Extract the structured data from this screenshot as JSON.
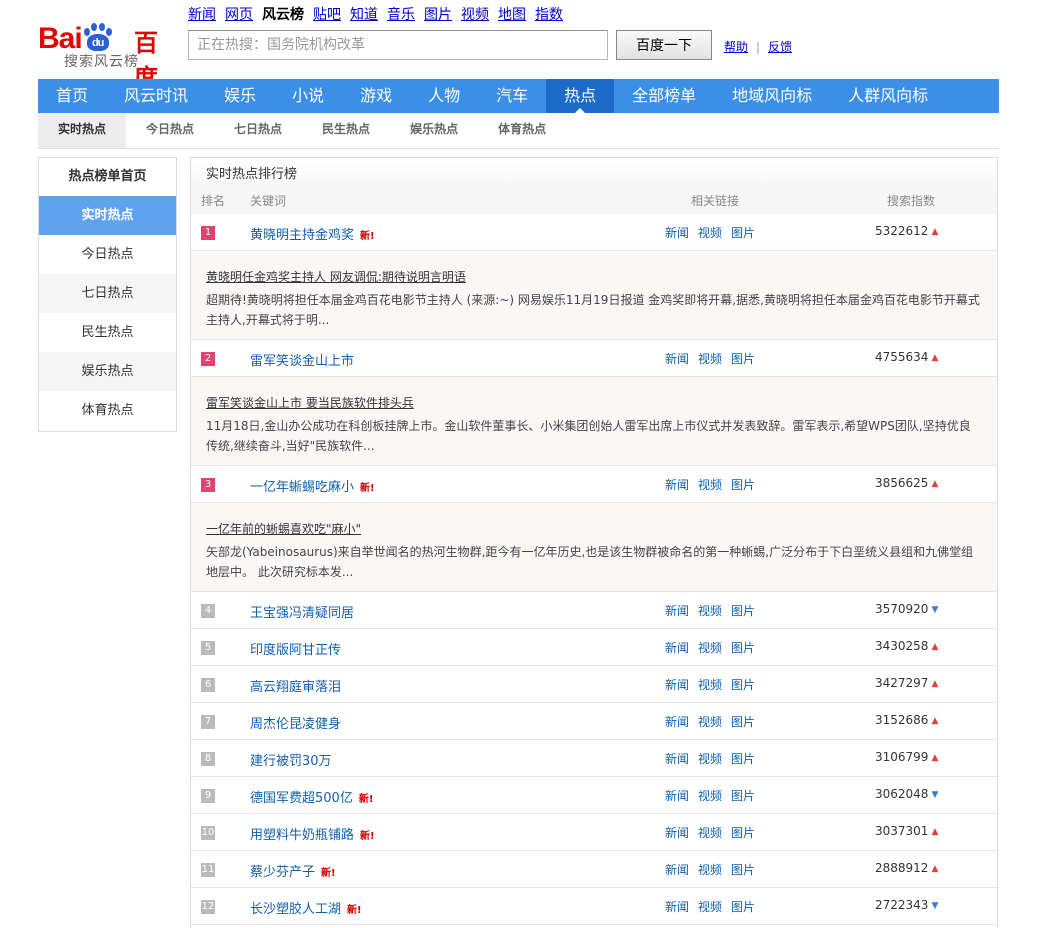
{
  "logo": {
    "latin_a": "Bai",
    "latin_b": "du",
    "cn": "百度",
    "sub": "搜索风云榜"
  },
  "topnav": [
    {
      "label": "新闻",
      "current": false
    },
    {
      "label": "网页",
      "current": false
    },
    {
      "label": "风云榜",
      "current": true
    },
    {
      "label": "贴吧",
      "current": false
    },
    {
      "label": "知道",
      "current": false
    },
    {
      "label": "音乐",
      "current": false
    },
    {
      "label": "图片",
      "current": false
    },
    {
      "label": "视频",
      "current": false
    },
    {
      "label": "地图",
      "current": false
    },
    {
      "label": "指数",
      "current": false
    }
  ],
  "search": {
    "value": "正在热搜：国务院机构改革",
    "button": "百度一下",
    "help": "帮助",
    "sep": "|",
    "feedback": "反馈"
  },
  "mainnav": [
    {
      "label": "首页",
      "current": false
    },
    {
      "label": "风云时讯",
      "current": false
    },
    {
      "label": "娱乐",
      "current": false
    },
    {
      "label": "小说",
      "current": false
    },
    {
      "label": "游戏",
      "current": false
    },
    {
      "label": "人物",
      "current": false
    },
    {
      "label": "汽车",
      "current": false
    },
    {
      "label": "热点",
      "current": true
    },
    {
      "label": "全部榜单",
      "current": false
    },
    {
      "label": "地域风向标",
      "current": false
    },
    {
      "label": "人群风向标",
      "current": false
    }
  ],
  "subnav": [
    {
      "label": "实时热点",
      "current": true
    },
    {
      "label": "今日热点",
      "current": false
    },
    {
      "label": "七日热点",
      "current": false
    },
    {
      "label": "民生热点",
      "current": false
    },
    {
      "label": "娱乐热点",
      "current": false
    },
    {
      "label": "体育热点",
      "current": false
    }
  ],
  "sidebar": {
    "head": "热点榜单首页",
    "items": [
      {
        "label": "实时热点",
        "current": true
      },
      {
        "label": "今日热点",
        "current": false
      },
      {
        "label": "七日热点",
        "current": false
      },
      {
        "label": "民生热点",
        "current": false
      },
      {
        "label": "娱乐热点",
        "current": false
      },
      {
        "label": "体育热点",
        "current": false
      }
    ]
  },
  "main": {
    "title": "实时热点排行榜",
    "columns": {
      "rank": "排名",
      "keyword": "关键词",
      "links": "相关链接",
      "index": "搜索指数"
    },
    "link_labels": [
      "新闻",
      "视频",
      "图片"
    ],
    "new_label": "新!",
    "rows": [
      {
        "rank": "1",
        "keyword": "黄晓明主持金鸡奖",
        "new": true,
        "index": "5322612",
        "trend": "up",
        "detail": {
          "title": "黄晓明任金鸡奖主持人 网友调侃:期待说明言明语",
          "text": "超期待!黄晓明将担任本届金鸡百花电影节主持人 (来源:~) 网易娱乐11月19日报道 金鸡奖即将开幕,据悉,黄晓明将担任本届金鸡百花电影节开幕式主持人,开幕式将于明..."
        }
      },
      {
        "rank": "2",
        "keyword": "雷军笑谈金山上市",
        "new": false,
        "index": "4755634",
        "trend": "up",
        "detail": {
          "title": "雷军笑谈金山上市 要当民族软件排头兵",
          "text": "11月18日,金山办公成功在科创板挂牌上市。金山软件董事长、小米集团创始人雷军出席上市仪式并发表致辞。雷军表示,希望WPS团队,坚持优良传统,继续奋斗,当好\"民族软件..."
        }
      },
      {
        "rank": "3",
        "keyword": "一亿年蜥蜴吃麻小",
        "new": true,
        "index": "3856625",
        "trend": "up",
        "detail": {
          "title": "一亿年前的蜥蜴喜欢吃\"麻小\"",
          "text": "矢部龙(Yabeinosaurus)来自举世闻名的热河生物群,距今有一亿年历史,也是该生物群被命名的第一种蜥蜴,广泛分布于下白垩统义县组和九佛堂组地层中。 此次研究标本发..."
        }
      },
      {
        "rank": "4",
        "keyword": "王宝强冯清疑同居",
        "new": false,
        "index": "3570920",
        "trend": "down"
      },
      {
        "rank": "5",
        "keyword": "印度版阿甘正传",
        "new": false,
        "index": "3430258",
        "trend": "up"
      },
      {
        "rank": "6",
        "keyword": "高云翔庭审落泪",
        "new": false,
        "index": "3427297",
        "trend": "up"
      },
      {
        "rank": "7",
        "keyword": "周杰伦昆凌健身",
        "new": false,
        "index": "3152686",
        "trend": "up"
      },
      {
        "rank": "8",
        "keyword": "建行被罚30万",
        "new": false,
        "index": "3106799",
        "trend": "up"
      },
      {
        "rank": "9",
        "keyword": "德国军费超500亿",
        "new": true,
        "index": "3062048",
        "trend": "down"
      },
      {
        "rank": "10",
        "keyword": "用塑料牛奶瓶铺路",
        "new": true,
        "index": "3037301",
        "trend": "up"
      },
      {
        "rank": "11",
        "keyword": "蔡少芬产子",
        "new": true,
        "index": "2888912",
        "trend": "up"
      },
      {
        "rank": "12",
        "keyword": "长沙塑胶人工湖",
        "new": true,
        "index": "2722343",
        "trend": "down"
      }
    ]
  }
}
